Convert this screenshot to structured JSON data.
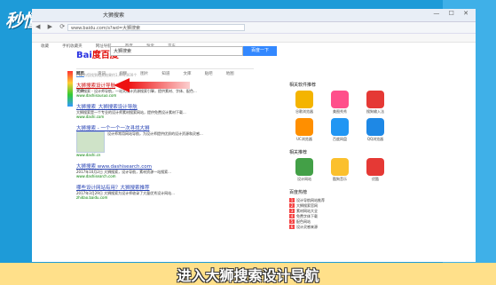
{
  "watermark": {
    "text": "秒懂视频"
  },
  "browser": {
    "window_title": "大狮搜索",
    "nav_icons": "◀ ▶ ⟳",
    "window_controls": "— ☐ ✕",
    "url": "www.baidu.com/s?wd=大狮搜索",
    "bookmarks": [
      "收藏",
      "手机收藏夹",
      "网址导航",
      "百度",
      "淘宝",
      "京东"
    ]
  },
  "search": {
    "logo_part1": "Bai",
    "logo_part2": "度百度",
    "query": "大狮搜索",
    "button": "百度一下"
  },
  "tabs": [
    "网页",
    "资讯",
    "视频",
    "图片",
    "知道",
    "文库",
    "贴吧",
    "地图",
    "更多"
  ],
  "result_count": "百度为您找到相关结果约1,970,000个",
  "results": [
    {
      "title": "大狮搜索设计导航",
      "snippet": "大狮搜索 - 设计师导航，一站式设计资源搜索引擎，提供素材、字体、配色...",
      "url": "www.dashisousuo.com"
    },
    {
      "title": "大狮搜索_大狮搜索设计导航",
      "snippet": "大狮搜索是一个专业的设计师素材搜索网站，提供免费设计素材下载...",
      "url": "www.dashi.com"
    },
    {
      "title": "大狮搜索 - 一个一个一次寻找大狮",
      "snippet": "设计师常用网站导航，为设计师提供优质的设计资源和灵感...",
      "url": "www.dashi.cn"
    },
    {
      "title": "大狮搜索 www.dashisearch.com",
      "snippet": "2017年10月2日 大狮搜索，设计导航，素材资源一站搜索...",
      "url": "www.dashisearch.com"
    },
    {
      "title": "哪些设计网站有用？大狮搜索推荐",
      "snippet": "2017年3月29日 大狮搜索为设计师收录了大量优秀设计网站...",
      "url": "zhidao.baidu.com"
    }
  ],
  "sidebar": {
    "section1": "相关软件推荐",
    "apps": [
      {
        "name": "谷歌浏览器",
        "color": "#f4b400"
      },
      {
        "name": "美图秀秀",
        "color": "#ff4f8b"
      },
      {
        "name": "搜狗输入法",
        "color": "#e53935"
      },
      {
        "name": "UC浏览器",
        "color": "#ff8f00"
      },
      {
        "name": "百度网盘",
        "color": "#2196f3"
      },
      {
        "name": "QQ浏览器",
        "color": "#1e88e5"
      }
    ],
    "section2": "相关推荐",
    "apps2": [
      {
        "name": "设计网站",
        "color": "#43a047"
      },
      {
        "name": "酷狗音乐",
        "color": "#fbc02d"
      },
      {
        "name": "优酷",
        "color": "#e53935"
      }
    ],
    "section3": "百度热榜",
    "hot": [
      "设计导航网站推荐",
      "大狮搜索官网",
      "素材网站大全",
      "免费字体下载",
      "配色网站",
      "设计灵感来源"
    ]
  },
  "subtitle": "进入大狮搜索设计导航"
}
